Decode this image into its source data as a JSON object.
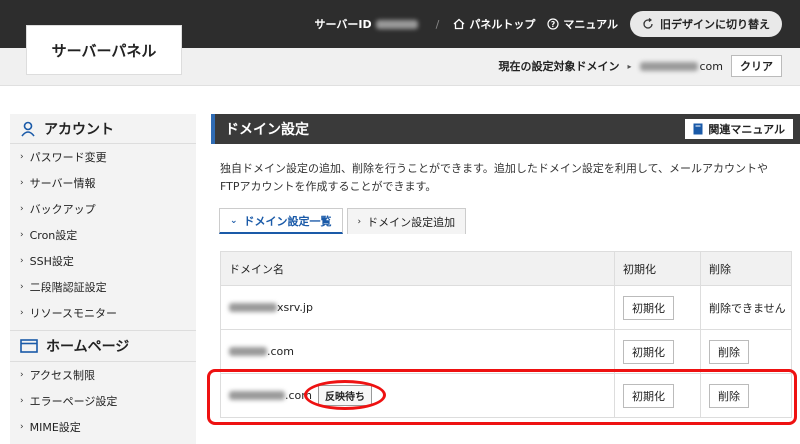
{
  "header": {
    "logo": "サーバーパネル",
    "server_id_label": "サーバーID",
    "separator": "/",
    "panel_top": "パネルトップ",
    "manual": "マニュアル",
    "old_design": "旧デザインに切り替え"
  },
  "subbar": {
    "target_label": "現在の設定対象ドメイン",
    "target_domain_suffix": "com",
    "clear": "クリア"
  },
  "sidebar": {
    "account_header": "アカウント",
    "account_items": [
      "パスワード変更",
      "サーバー情報",
      "バックアップ",
      "Cron設定",
      "SSH設定",
      "二段階認証設定",
      "リソースモニター"
    ],
    "homepage_header": "ホームページ",
    "homepage_items": [
      "アクセス制限",
      "エラーページ設定",
      "MIME設定"
    ]
  },
  "main": {
    "title": "ドメイン設定",
    "manual_button": "関連マニュアル",
    "description": "独自ドメイン設定の追加、削除を行うことができます。追加したドメイン設定を利用して、メールアカウントやFTPアカウントを作成することができます。",
    "tabs": [
      {
        "label": "ドメイン設定一覧"
      },
      {
        "label": "ドメイン設定追加"
      }
    ],
    "table": {
      "headers": [
        "ドメイン名",
        "初期化",
        "削除"
      ],
      "rows": [
        {
          "suffix": "xsrv.jp",
          "init": "初期化",
          "delete_text": "削除できません"
        },
        {
          "suffix": ".com",
          "init": "初期化",
          "delete": "削除"
        },
        {
          "suffix": ".com",
          "badge": "反映待ち",
          "init": "初期化",
          "delete": "削除"
        }
      ]
    }
  },
  "colors": {
    "accent_blue": "#1a5aa8",
    "highlight_red": "#e11111",
    "topbar": "#2d2d2d"
  }
}
